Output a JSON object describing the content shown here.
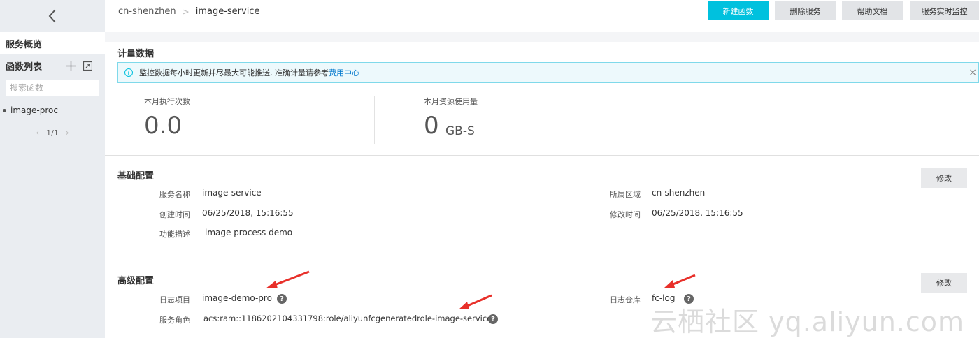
{
  "sidebar": {
    "overview_label": "服务概览",
    "function_list_title": "函数列表",
    "search_placeholder": "搜索函数",
    "functions": [
      "image-proc"
    ],
    "pager": "1/1"
  },
  "header": {
    "breadcrumb": [
      "cn-shenzhen",
      "image-service"
    ],
    "buttons": {
      "new_function": "新建函数",
      "delete_service": "删除服务",
      "help_docs": "帮助文档",
      "realtime_monitor": "服务实时监控"
    }
  },
  "metering": {
    "title": "计量数据",
    "notice_text": "监控数据每小时更新并尽最大可能推送, 准确计量请参考",
    "notice_link": "费用中心",
    "metrics": [
      {
        "label": "本月执行次数",
        "value": "0.0",
        "unit": ""
      },
      {
        "label": "本月资源使用量",
        "value": "0",
        "unit": "GB-S"
      }
    ]
  },
  "basic_config": {
    "title": "基础配置",
    "edit_label": "修改",
    "service_name_label": "服务名称",
    "service_name": "image-service",
    "region_label": "所属区域",
    "region": "cn-shenzhen",
    "created_label": "创建时间",
    "created": "06/25/2018, 15:16:55",
    "modified_label": "修改时间",
    "modified": "06/25/2018, 15:16:55",
    "description_label": "功能描述",
    "description": "image process demo"
  },
  "advanced_config": {
    "title": "高级配置",
    "edit_label": "修改",
    "log_project_label": "日志项目",
    "log_project": "image-demo-pro",
    "log_store_label": "日志仓库",
    "log_store": "fc-log",
    "role_label": "服务角色",
    "role": "acs:ram::1186202104331798:role/aliyunfcgeneratedrole-image-service"
  },
  "watermark": "云栖社区 yq.aliyun.com",
  "colors": {
    "primary": "#00c1de",
    "annotation_arrow": "#e8302a",
    "sidebar_bg": "#eaedf1"
  }
}
